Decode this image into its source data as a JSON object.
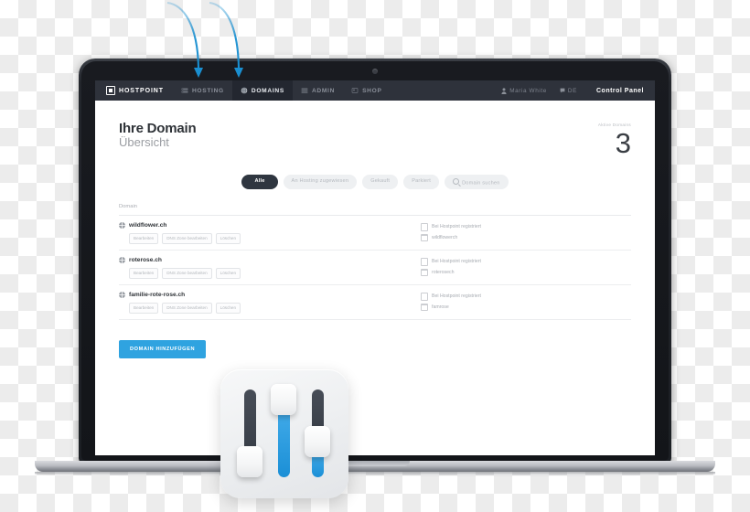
{
  "browser": {
    "brand": "HOSTPOINT",
    "tabs": [
      {
        "label": "HOSTING",
        "icon": "server-icon",
        "active": false
      },
      {
        "label": "DOMAINS",
        "icon": "globe-icon",
        "active": true
      },
      {
        "label": "ADMIN",
        "icon": "sliders-icon",
        "active": false
      },
      {
        "label": "SHOP",
        "icon": "cart-icon",
        "active": false
      }
    ],
    "user": "Maria White",
    "language": "DE",
    "control_panel": "Control Panel"
  },
  "page": {
    "title": "Ihre Domain",
    "subtitle": "Übersicht",
    "counter_label": "Aktive Domains",
    "counter_value": "3"
  },
  "filters": [
    {
      "label": "Alle",
      "active": true,
      "icon": ""
    },
    {
      "label": "An Hosting zugewiesen",
      "active": false,
      "icon": ""
    },
    {
      "label": "Gekauft",
      "active": false,
      "icon": ""
    },
    {
      "label": "Parkiert",
      "active": false,
      "icon": ""
    },
    {
      "label": "Domain suchen",
      "active": false,
      "icon": "search-icon"
    }
  ],
  "table": {
    "header": "Domain",
    "actions": {
      "edit": "Bearbeiten",
      "dns": "DNS Zone bearbeiten",
      "delete": "Löschen"
    },
    "rows": [
      {
        "domain": "wildflower.ch",
        "status": "Bei Hostpoint registriert",
        "account": "wildflowerch"
      },
      {
        "domain": "roterose.ch",
        "status": "Bei Hostpoint registriert",
        "account": "roterosech"
      },
      {
        "domain": "familie-rote-rose.ch",
        "status": "Bei Hostpoint registriert",
        "account": "famrose"
      }
    ]
  },
  "add_button": "DOMAIN HINZUFÜGEN",
  "colors": {
    "accent": "#2fa3e0",
    "nav_bg": "#2e323b",
    "nav_active": "#232730",
    "arrow": "#1a8fd0"
  }
}
